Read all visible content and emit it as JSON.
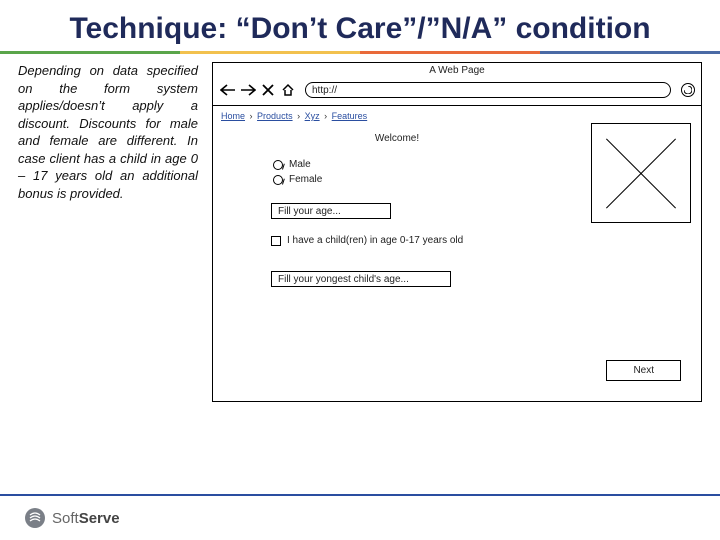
{
  "title_line1": "Technique: ",
  "title_line2": "“Don’t Care”/”N/A” condition",
  "description": "Depending on data specified on the form system applies/doesn’t apply a discount. Discounts for male and female are different. In case client has a child in age 0 – 17 years old an additional bonus is provided.",
  "mockup": {
    "window_title": "A Web Page",
    "url": "http://",
    "breadcrumb": [
      "Home",
      "Products",
      "Xyz",
      "Features"
    ],
    "welcome": "Welcome!",
    "radio_male": "Male",
    "radio_female": "Female",
    "age_placeholder": "Fill your age...",
    "checkbox_label": "I have a child(ren) in age 0-17 years old",
    "child_age_placeholder": "Fill your yongest child's age...",
    "next_button": "Next"
  },
  "footer": {
    "brand_normal": "Soft",
    "brand_bold": "Serve"
  }
}
